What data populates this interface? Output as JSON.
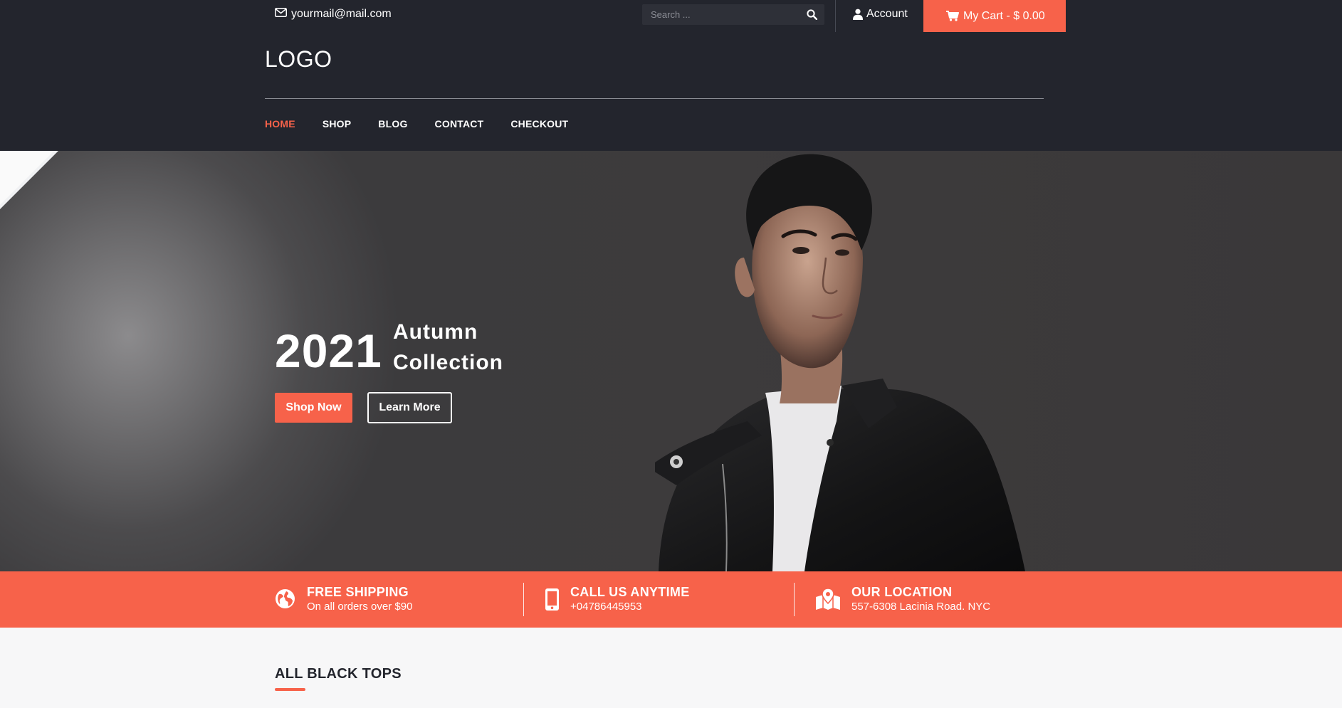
{
  "topbar": {
    "email": "yourmail@mail.com",
    "search_placeholder": "Search ...",
    "account_label": "Account",
    "cart_label": "My Cart - $ 0.00"
  },
  "header": {
    "logo": "LOGO",
    "nav": [
      {
        "label": "HOME",
        "active": true
      },
      {
        "label": "SHOP"
      },
      {
        "label": "BLOG"
      },
      {
        "label": "CONTACT"
      },
      {
        "label": "CHECKOUT"
      }
    ]
  },
  "hero": {
    "year": "2021",
    "collection_line1": "Autumn",
    "collection_line2": "Collection",
    "shop_button": "Shop Now",
    "learn_button": "Learn More"
  },
  "features": [
    {
      "icon": "globe-icon",
      "title": "FREE SHIPPING",
      "subtitle": "On all orders over $90"
    },
    {
      "icon": "mobile-phone-icon",
      "title": "CALL US ANYTIME",
      "subtitle": "+04786445953"
    },
    {
      "icon": "map-location-icon",
      "title": "OUR LOCATION",
      "subtitle": "557-6308 Lacinia Road. NYC"
    }
  ],
  "section": {
    "title": "ALL BLACK TOPS"
  },
  "colors": {
    "accent": "#f7624a",
    "dark": "#23252d",
    "light_bg": "#f7f7f8"
  }
}
